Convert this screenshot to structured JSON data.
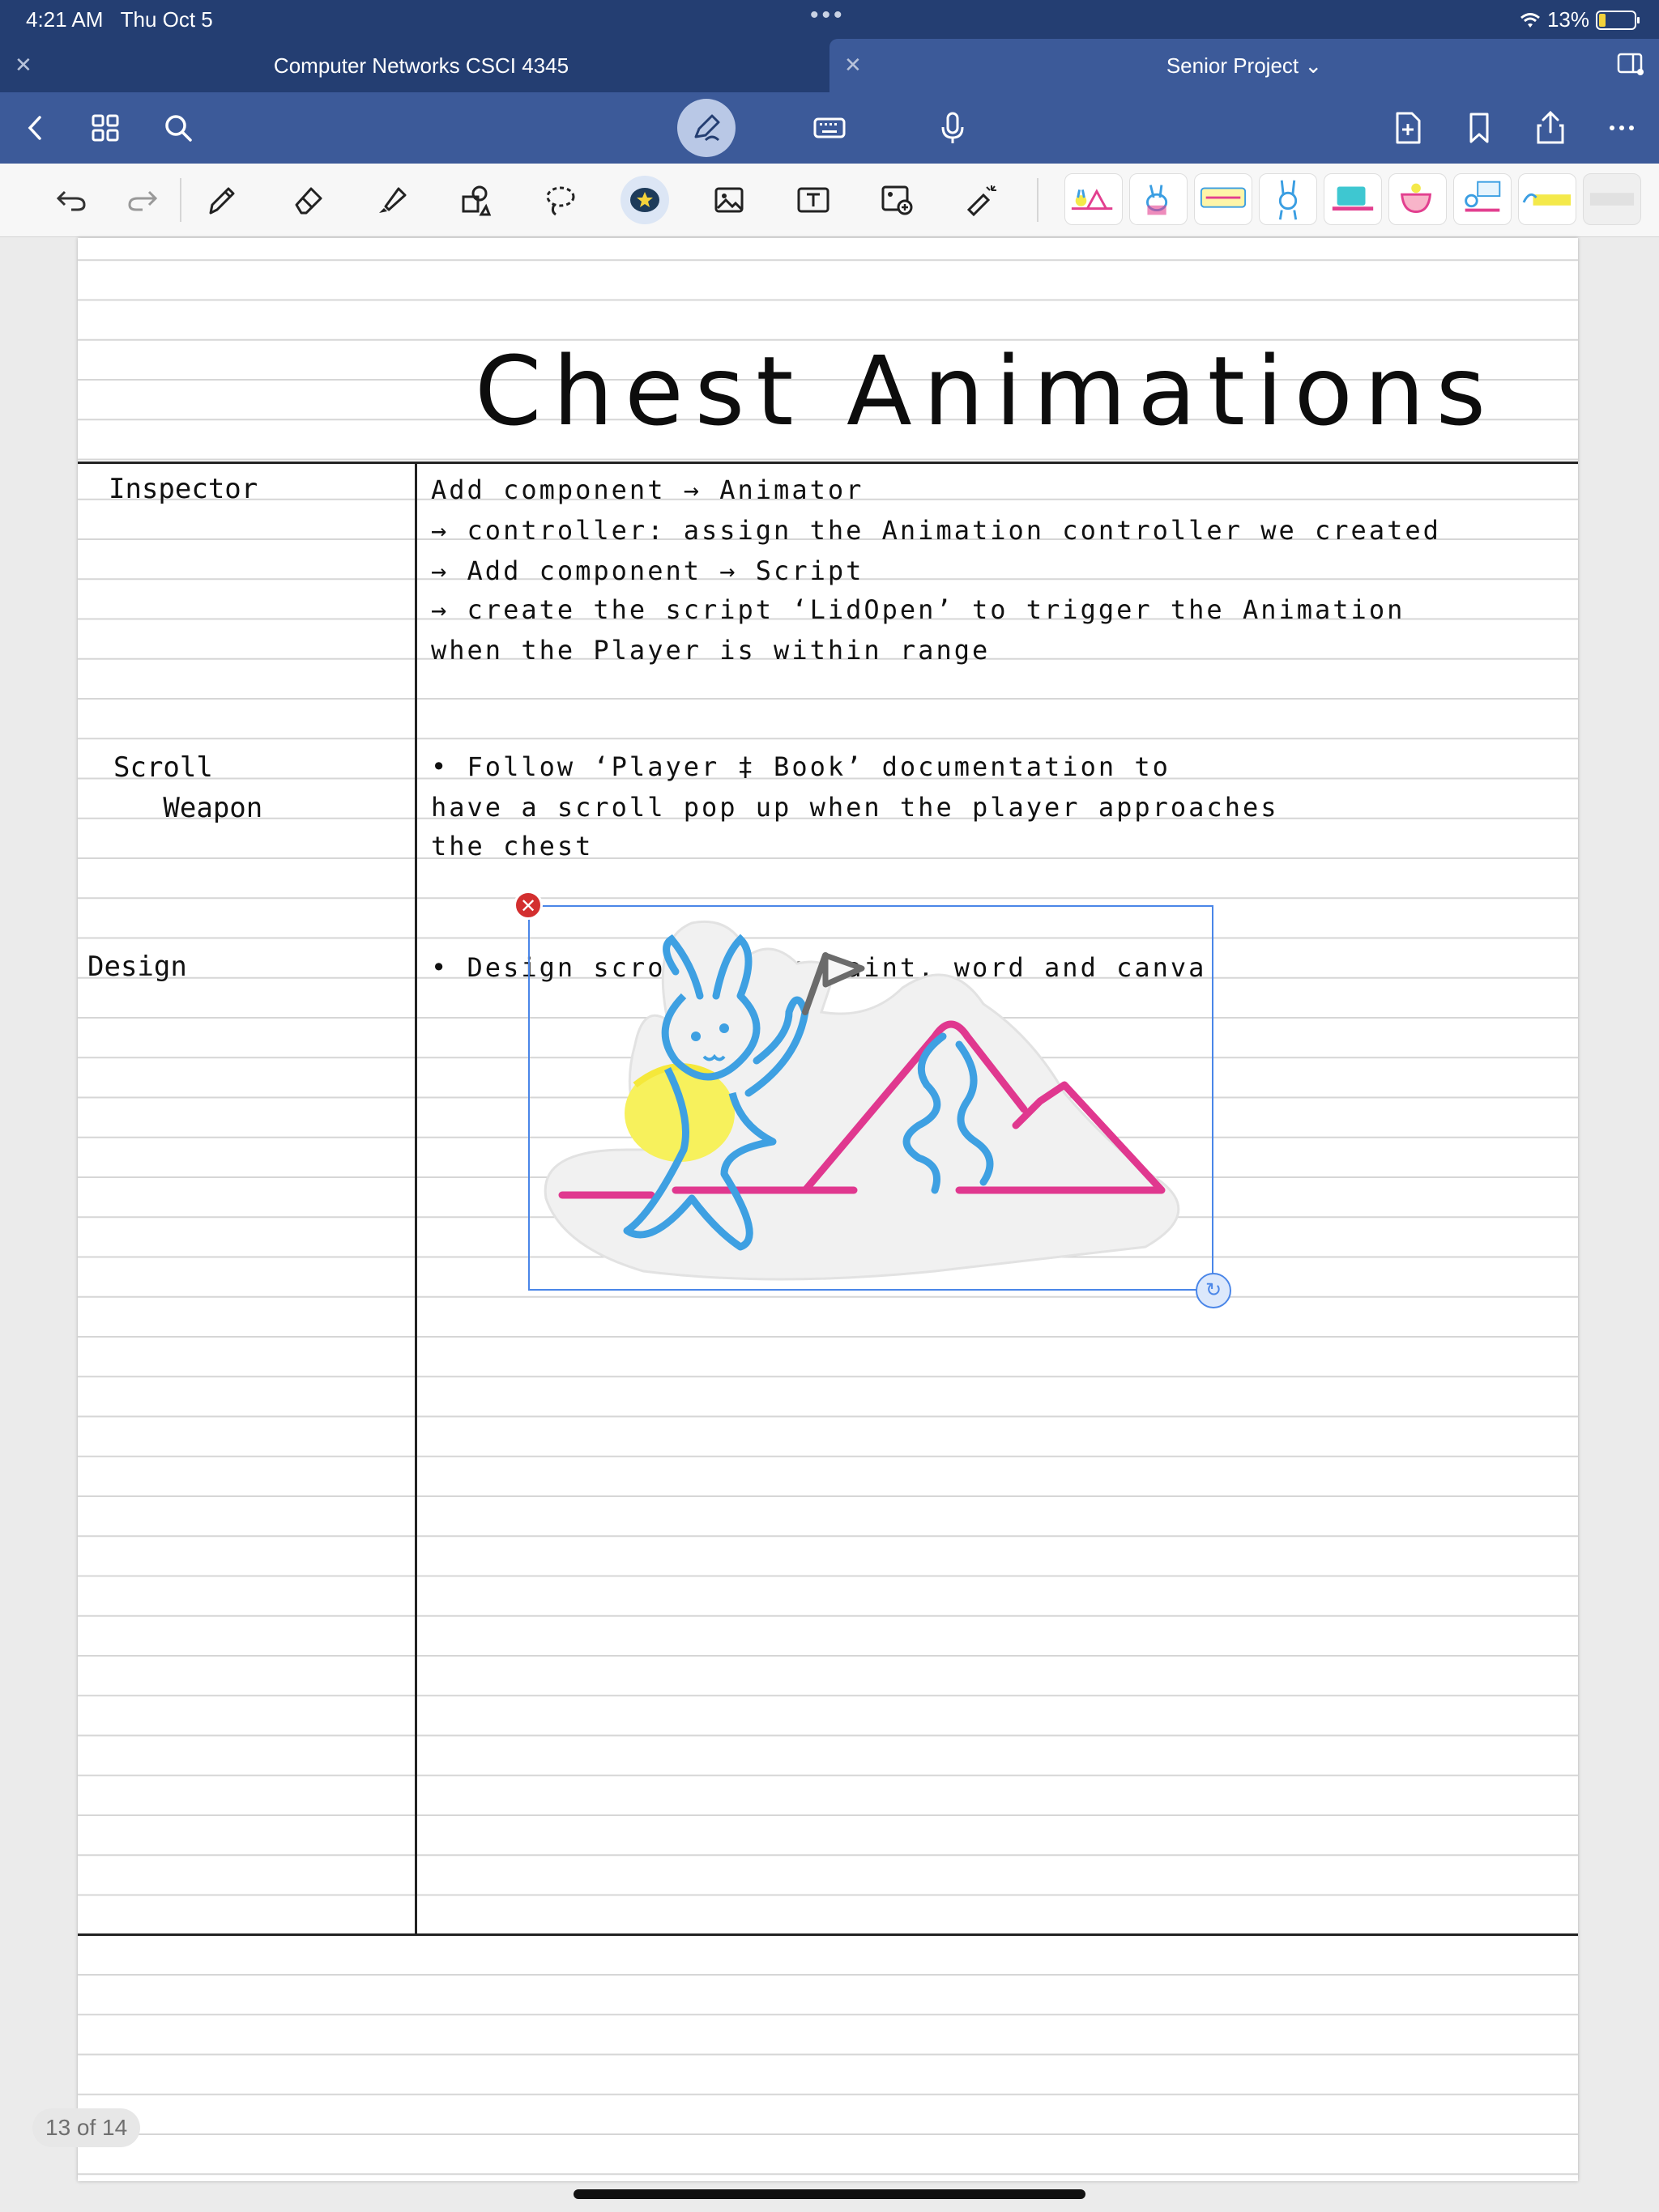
{
  "status": {
    "time": "4:21 AM",
    "date": "Thu Oct 5",
    "battery": "13%"
  },
  "tabs": [
    {
      "label": "Computer Networks CSCI 4345"
    },
    {
      "label": "Senior Project"
    }
  ],
  "icons": {
    "back": "chevron-left-icon",
    "grid": "grid-icon",
    "search": "search-icon",
    "pen_mode": "pen-mode-icon",
    "keyboard": "keyboard-icon",
    "mic": "microphone-icon",
    "add_page": "add-page-icon",
    "bookmark": "bookmark-icon",
    "share": "share-icon",
    "more": "more-icon"
  },
  "notes": {
    "title": "Chest Animations",
    "rows": [
      {
        "label_lines": [
          "Inspector"
        ],
        "lines": [
          "Add  component → Animator",
          "→ controller:  assign  the   Animation  controller  we  created",
          "→  Add  component →  Script",
          "→   create   the script   ‘LidOpen’   to   trigger    the   Animation",
          "when   the   Player   is   within  range"
        ]
      },
      {
        "label_lines": [
          "Scroll",
          "   Weapon"
        ],
        "lines": [
          "•   Follow  ‘Player ‡ Book’  documentation   to",
          "have   a   scroll   pop  up   when   the   player   approaches",
          "the   chest"
        ]
      },
      {
        "label_lines": [
          "Design"
        ],
        "lines": [
          "•  Design  scroll  using  paint,  word  and  canva"
        ]
      }
    ]
  },
  "page_indicator": "13 of 14",
  "colors": {
    "header": "#243e72",
    "nav": "#3c5a99",
    "selection": "#4a86e8",
    "ink": "#111111"
  }
}
